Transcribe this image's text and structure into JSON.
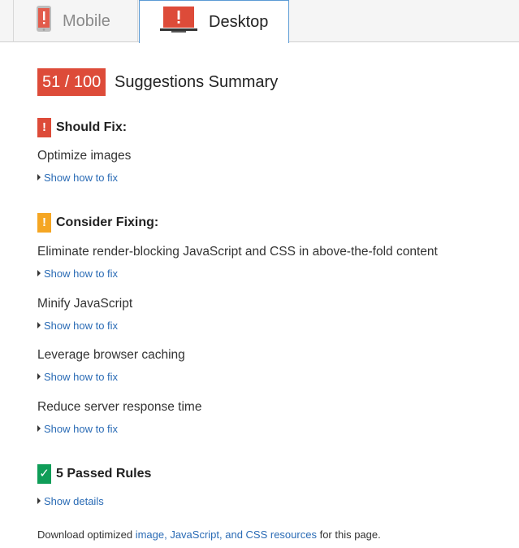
{
  "tabs": {
    "mobile": {
      "label": "Mobile",
      "icon": "mobile-phone-icon",
      "color": "#dd4b39"
    },
    "desktop": {
      "label": "Desktop",
      "icon": "desktop-monitor-icon",
      "color": "#dd4b39",
      "active": true
    }
  },
  "summary": {
    "score": "51 / 100",
    "title": "Suggestions Summary",
    "score_color": "#dd4b39"
  },
  "should_fix": {
    "badge": "!",
    "title": "Should Fix:",
    "color": "#dd4b39",
    "rules": [
      {
        "label": "Optimize images",
        "link": "Show how to fix"
      }
    ]
  },
  "consider_fixing": {
    "badge": "!",
    "title": "Consider Fixing:",
    "color": "#f5a623",
    "rules": [
      {
        "label": "Eliminate render-blocking JavaScript and CSS in above-the-fold content",
        "link": "Show how to fix"
      },
      {
        "label": "Minify JavaScript",
        "link": "Show how to fix"
      },
      {
        "label": "Leverage browser caching",
        "link": "Show how to fix"
      },
      {
        "label": "Reduce server response time",
        "link": "Show how to fix"
      }
    ]
  },
  "passed": {
    "badge": "✓",
    "title": "5 Passed Rules",
    "color": "#0f9d58",
    "link": "Show details"
  },
  "footer": {
    "prefix": "Download optimized ",
    "link": "image, JavaScript, and CSS resources",
    "suffix": " for this page."
  }
}
